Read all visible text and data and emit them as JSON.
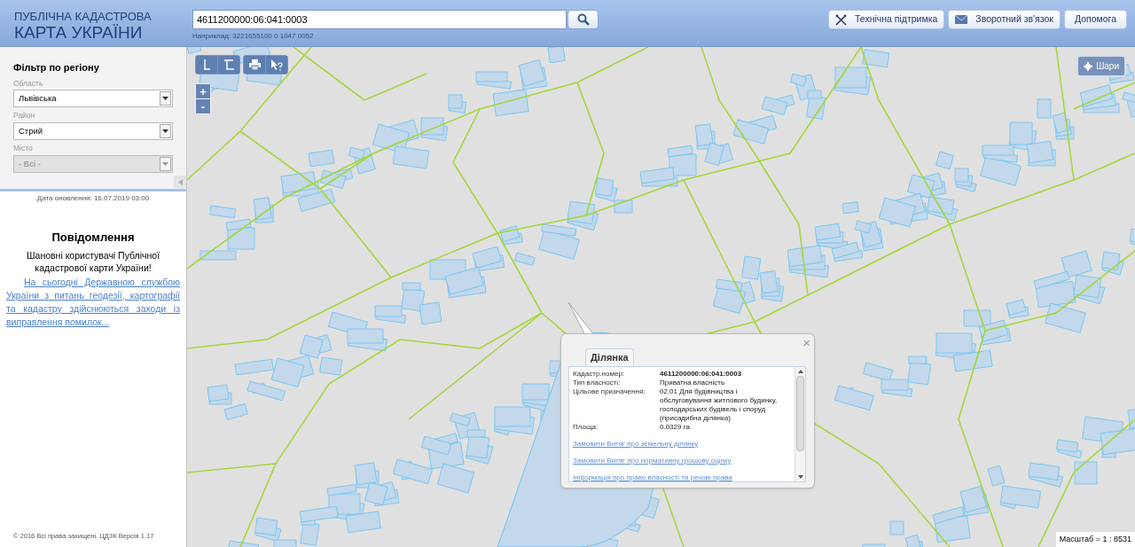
{
  "header": {
    "logo_line1": "ПУБЛІЧНА КАДАСТРОВА",
    "logo_line2": "КАРТА УКРАЇНИ",
    "search": {
      "value": "4611200000:06:041:0003",
      "hint": "Наприклад: 3221655100 0 1047 0052"
    },
    "buttons": [
      {
        "label": "Технічна підтримка",
        "kind": "support"
      },
      {
        "label": "Зворотний зв'язок",
        "kind": "feedback"
      },
      {
        "label": "Допомога",
        "kind": "help"
      }
    ]
  },
  "sidebar": {
    "filter_title": "Фільтр по регіону",
    "fields": [
      {
        "label": "Область",
        "value": "Львівська",
        "disabled": false
      },
      {
        "label": "Район",
        "value": "Стрий",
        "disabled": false
      },
      {
        "label": "Місто",
        "value": "- Всі -",
        "disabled": true
      }
    ],
    "update_date": "Дата оновлення: 16.07.2019 03:00",
    "notice": {
      "title": "Повідомлення",
      "greeting": "Шановні користувачі Публічної кадастрової карти України!",
      "link": "На сьогодні Державною службою України з питань геодезії, картографії та кадастру здійснюються заходи із виправлення помилок..."
    },
    "footer": "© 2016 Всі права захищені. ЦДЗК Версія 1.17"
  },
  "map": {
    "zoom_in": "+",
    "zoom_out": "-",
    "layers_button": "Шари",
    "scale": "Масштаб = 1 : 8531",
    "popup": {
      "tab": "Ділянка",
      "close": "×",
      "rows": [
        {
          "label": "Кадастр.номер:",
          "value": "4611200000:06:041:0003",
          "bold": true
        },
        {
          "label": "Тип власності:",
          "value": "Приватна власність",
          "bold": false
        },
        {
          "label": "Цільове призначення:",
          "value": "02.01 Для будівництва і обслуговування житлового будинку, господарських будівель і споруд (присадибна ділянка)",
          "bold": false
        },
        {
          "label": "Площа:",
          "value": "0.0329 га",
          "bold": false
        }
      ],
      "links": [
        "Замовити Витяг про земельну ділянку",
        "Замовити Витяг про нормативну грошову оцінку",
        "Інформація про право власності та речові права"
      ]
    }
  }
}
